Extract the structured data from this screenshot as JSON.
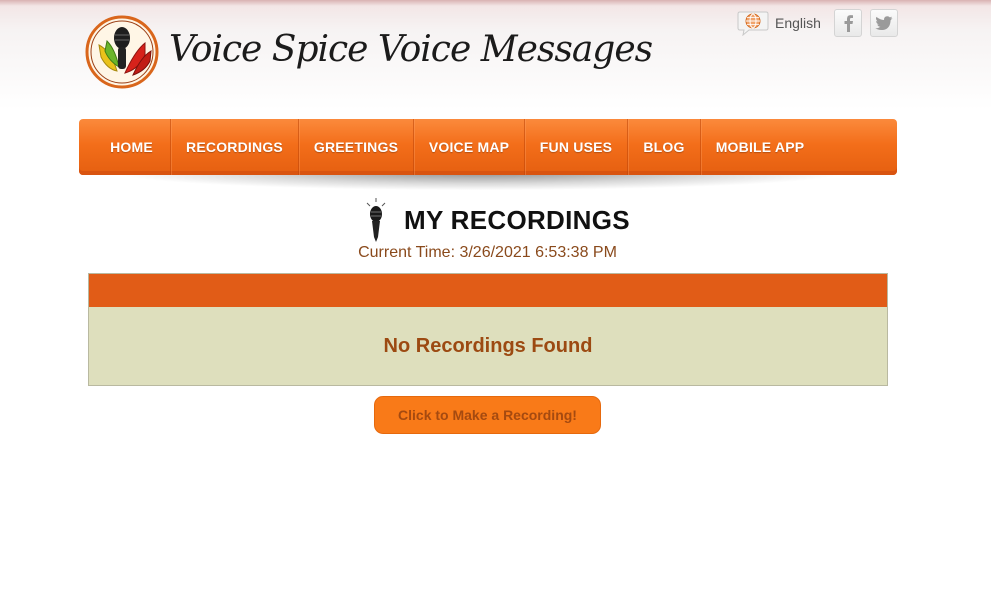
{
  "header": {
    "logo_text": "Voice Spice Voice Messages",
    "language_label": "English"
  },
  "nav": {
    "items": [
      {
        "label": "HOME"
      },
      {
        "label": "RECORDINGS"
      },
      {
        "label": "GREETINGS"
      },
      {
        "label": "VOICE MAP"
      },
      {
        "label": "FUN USES"
      },
      {
        "label": "BLOG"
      },
      {
        "label": "MOBILE APP"
      }
    ]
  },
  "main": {
    "title": "MY RECORDINGS",
    "current_time": "Current Time: 3/26/2021 6:53:38 PM",
    "empty_message": "No Recordings Found",
    "make_recording_label": "Click to Make a Recording!"
  },
  "colors": {
    "nav_orange": "#f36e1a",
    "table_header": "#e15c17",
    "table_body": "#dedfbd",
    "message_text": "#9c4a12",
    "button_bg": "#f97a18"
  },
  "icons": {
    "logo": "microphone-chili-logo",
    "language": "globe-chat-icon",
    "facebook": "facebook-icon",
    "twitter": "twitter-icon",
    "title": "microphone-icon"
  }
}
